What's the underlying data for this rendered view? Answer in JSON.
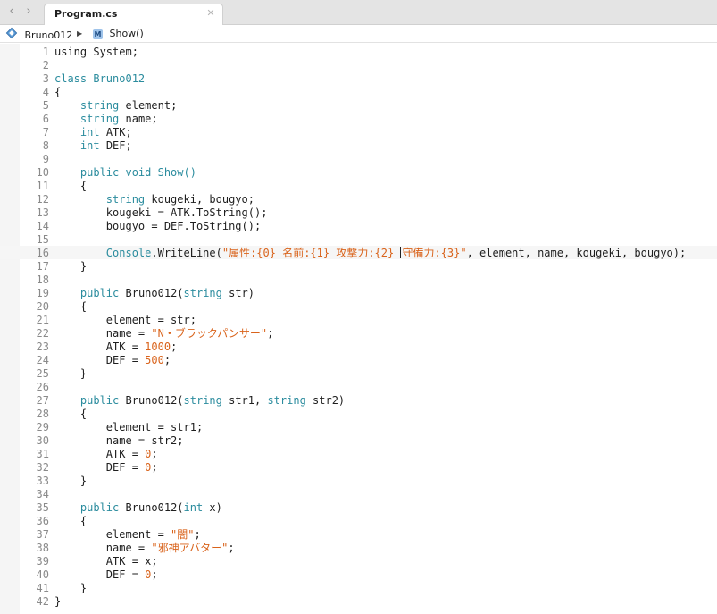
{
  "tab": {
    "title": "Program.cs"
  },
  "breadcrumb": {
    "class_name": "Bruno012",
    "method_badge": "M",
    "method_name": "Show()"
  },
  "editor": {
    "current_line": 16,
    "lines": [
      {
        "n": "1",
        "code": [
          [
            "using System;",
            ""
          ]
        ]
      },
      {
        "n": "2",
        "code": []
      },
      {
        "n": "3",
        "code": [
          [
            "class Bruno012",
            "kw"
          ]
        ]
      },
      {
        "n": "4",
        "code": [
          [
            "{",
            ""
          ]
        ]
      },
      {
        "n": "5",
        "code": [
          [
            "    ",
            ""
          ],
          [
            "string",
            "kw"
          ],
          [
            " element;",
            ""
          ]
        ]
      },
      {
        "n": "6",
        "code": [
          [
            "    ",
            ""
          ],
          [
            "string",
            "kw"
          ],
          [
            " name;",
            ""
          ]
        ]
      },
      {
        "n": "7",
        "code": [
          [
            "    ",
            ""
          ],
          [
            "int",
            "kw"
          ],
          [
            " ATK;",
            ""
          ]
        ]
      },
      {
        "n": "8",
        "code": [
          [
            "    ",
            ""
          ],
          [
            "int",
            "kw"
          ],
          [
            " DEF;",
            ""
          ]
        ]
      },
      {
        "n": "9",
        "code": []
      },
      {
        "n": "10",
        "code": [
          [
            "    ",
            ""
          ],
          [
            "public void Show()",
            "kw"
          ]
        ]
      },
      {
        "n": "11",
        "code": [
          [
            "    {",
            ""
          ]
        ]
      },
      {
        "n": "12",
        "code": [
          [
            "        ",
            ""
          ],
          [
            "string",
            "kw"
          ],
          [
            " kougeki, bougyo;",
            ""
          ]
        ]
      },
      {
        "n": "13",
        "code": [
          [
            "        kougeki = ATK.ToString();",
            ""
          ]
        ]
      },
      {
        "n": "14",
        "code": [
          [
            "        bougyo = DEF.ToString();",
            ""
          ]
        ]
      },
      {
        "n": "15",
        "code": []
      },
      {
        "n": "16",
        "code": [
          [
            "        ",
            ""
          ],
          [
            "Console",
            "kw"
          ],
          [
            ".WriteLine(",
            ""
          ],
          [
            "\"属性:{0} 名前:{1} 攻撃力:{2} ",
            "str"
          ],
          [
            "|caret|",
            "caret"
          ],
          [
            "守備力:{3}\"",
            "str"
          ],
          [
            ", element, name, kougeki, bougyo);",
            ""
          ]
        ]
      },
      {
        "n": "17",
        "code": [
          [
            "    }",
            ""
          ]
        ]
      },
      {
        "n": "18",
        "code": []
      },
      {
        "n": "19",
        "code": [
          [
            "    ",
            ""
          ],
          [
            "public",
            "kw"
          ],
          [
            " Bruno012(",
            ""
          ],
          [
            "string",
            "kw"
          ],
          [
            " str)",
            ""
          ]
        ]
      },
      {
        "n": "20",
        "code": [
          [
            "    {",
            ""
          ]
        ]
      },
      {
        "n": "21",
        "code": [
          [
            "        element = str;",
            ""
          ]
        ]
      },
      {
        "n": "22",
        "code": [
          [
            "        name = ",
            ""
          ],
          [
            "\"N・ブラックパンサー\"",
            "str"
          ],
          [
            ";",
            ""
          ]
        ]
      },
      {
        "n": "23",
        "code": [
          [
            "        ATK = ",
            ""
          ],
          [
            "1000",
            "num"
          ],
          [
            ";",
            ""
          ]
        ]
      },
      {
        "n": "24",
        "code": [
          [
            "        DEF = ",
            ""
          ],
          [
            "500",
            "num"
          ],
          [
            ";",
            ""
          ]
        ]
      },
      {
        "n": "25",
        "code": [
          [
            "    }",
            ""
          ]
        ]
      },
      {
        "n": "26",
        "code": []
      },
      {
        "n": "27",
        "code": [
          [
            "    ",
            ""
          ],
          [
            "public",
            "kw"
          ],
          [
            " Bruno012(",
            ""
          ],
          [
            "string",
            "kw"
          ],
          [
            " str1, ",
            ""
          ],
          [
            "string",
            "kw"
          ],
          [
            " str2)",
            ""
          ]
        ]
      },
      {
        "n": "28",
        "code": [
          [
            "    {",
            ""
          ]
        ]
      },
      {
        "n": "29",
        "code": [
          [
            "        element = str1;",
            ""
          ]
        ]
      },
      {
        "n": "30",
        "code": [
          [
            "        name = str2;",
            ""
          ]
        ]
      },
      {
        "n": "31",
        "code": [
          [
            "        ATK = ",
            ""
          ],
          [
            "0",
            "num"
          ],
          [
            ";",
            ""
          ]
        ]
      },
      {
        "n": "32",
        "code": [
          [
            "        DEF = ",
            ""
          ],
          [
            "0",
            "num"
          ],
          [
            ";",
            ""
          ]
        ]
      },
      {
        "n": "33",
        "code": [
          [
            "    }",
            ""
          ]
        ]
      },
      {
        "n": "34",
        "code": []
      },
      {
        "n": "35",
        "code": [
          [
            "    ",
            ""
          ],
          [
            "public",
            "kw"
          ],
          [
            " Bruno012(",
            ""
          ],
          [
            "int",
            "kw"
          ],
          [
            " x)",
            ""
          ]
        ]
      },
      {
        "n": "36",
        "code": [
          [
            "    {",
            ""
          ]
        ]
      },
      {
        "n": "37",
        "code": [
          [
            "        element = ",
            ""
          ],
          [
            "\"闇\"",
            "str"
          ],
          [
            ";",
            ""
          ]
        ]
      },
      {
        "n": "38",
        "code": [
          [
            "        name = ",
            ""
          ],
          [
            "\"邪神アバター\"",
            "str"
          ],
          [
            ";",
            ""
          ]
        ]
      },
      {
        "n": "39",
        "code": [
          [
            "        ATK = x;",
            ""
          ]
        ]
      },
      {
        "n": "40",
        "code": [
          [
            "        DEF = ",
            ""
          ],
          [
            "0",
            "num"
          ],
          [
            ";",
            ""
          ]
        ]
      },
      {
        "n": "41",
        "code": [
          [
            "    }",
            ""
          ]
        ]
      },
      {
        "n": "42",
        "code": [
          [
            "}",
            ""
          ]
        ]
      }
    ]
  },
  "colors": {
    "keyword": "#2b8c9e",
    "string": "#d9631b",
    "text": "#1e1e1e",
    "line_number": "#8a8a8a"
  }
}
